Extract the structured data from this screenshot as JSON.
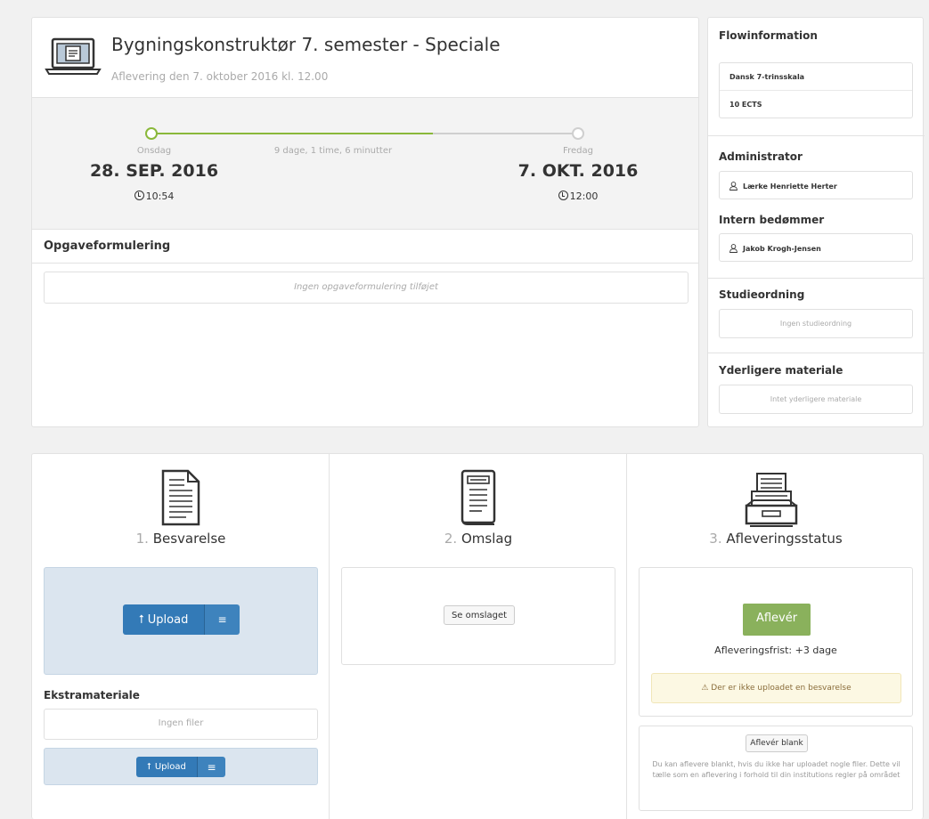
{
  "assignment": {
    "title": "Bygningskonstruktør 7. semester - Speciale",
    "subtitle": "Aflevering den 7. oktober 2016 kl. 12.00"
  },
  "timeline": {
    "start": {
      "day": "Onsdag",
      "date": "28. SEP. 2016",
      "time": "10:54"
    },
    "end": {
      "day": "Fredag",
      "date": "7. OKT. 2016",
      "time": "12:00"
    },
    "duration": "9 dage, 1 time, 6 minutter",
    "progress": 0.66
  },
  "assignment_text": {
    "heading": "Opgaveformulering",
    "empty": "Ingen opgaveformulering tilføjet"
  },
  "flow": {
    "heading": "Flowinformation",
    "items": [
      "Dansk 7-trinsskala",
      "10 ECTS"
    ],
    "administrator_heading": "Administrator",
    "administrator": "Lærke Henriette Herter",
    "internal_grader_heading": "Intern bedømmer",
    "internal_grader": "Jakob Krogh-Jensen",
    "curriculum_heading": "Studieordning",
    "curriculum_empty": "Ingen studieordning",
    "extra_heading": "Yderligere materiale",
    "extra_empty": "Intet yderligere materiale"
  },
  "steps": {
    "answer": {
      "num": "1.",
      "title": "Besvarelse",
      "upload_label": "Upload"
    },
    "extra": {
      "heading": "Ekstramateriale",
      "empty": "Ingen filer",
      "upload_label": "Upload"
    },
    "cover": {
      "num": "2.",
      "title": "Omslag",
      "view_label": "Se omslaget"
    },
    "status": {
      "num": "3.",
      "title": "Afleveringsstatus",
      "submit_label": "Aflevér",
      "deadline": "Afleveringsfrist: +3 dage",
      "warning": "Der er ikke uploadet en besvarelse",
      "blank_label": "Aflevér blank",
      "blank_note": "Du kan aflevere blankt, hvis du ikke har uploadet nogle filer. Dette vil tælle som en aflevering i forhold til din institutions regler på området"
    }
  },
  "colors": {
    "accent": "#337ab7",
    "success": "#8ab15c",
    "progress": "#8ab83a",
    "warning_bg": "#fcf8e3"
  }
}
